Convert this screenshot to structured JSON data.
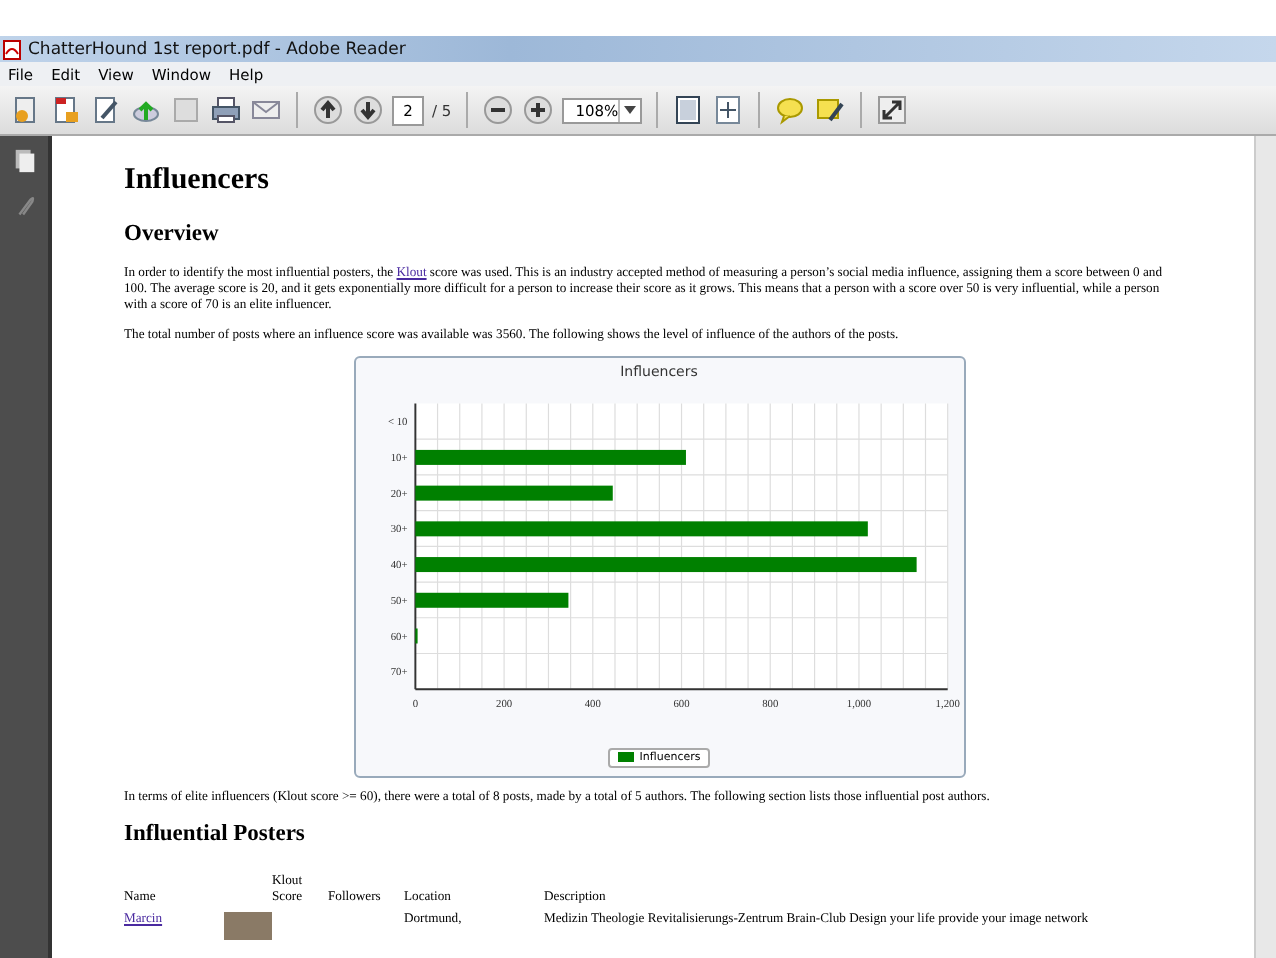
{
  "window": {
    "title": "ChatterHound 1st report.pdf - Adobe Reader"
  },
  "menu": [
    "File",
    "Edit",
    "View",
    "Window",
    "Help"
  ],
  "toolbar": {
    "page": "2",
    "page_count": "/ 5",
    "zoom": "108%"
  },
  "document": {
    "heading": "Influencers",
    "subheading": "Overview",
    "intro": {
      "before": "In order to identify the most influential posters, the",
      "link": "Klout",
      "after": "score was used. This is an industry accepted method of measuring a person’s social media influence, assigning them a score between 0 and 100. The average score is 20, and it gets exponentially more difficult for a person to increase their score as it grows. This means that a person with a score over 50 is very influential, while a person with a score of 70 is an elite influencer."
    },
    "paragraphs": [
      "The total number of posts where an influence score was available was 3560. The following shows the level of influence of the authors of the posts."
    ],
    "chart_data": {
      "type": "bar",
      "orientation": "horizontal",
      "title": "Influencers",
      "categories": [
        "< 10",
        "10+",
        "20+",
        "30+",
        "40+",
        "50+",
        "60+",
        "70+"
      ],
      "series": [
        {
          "name": "Influencers",
          "color": "#008000",
          "values": [
            0,
            610,
            445,
            1020,
            1130,
            345,
            5,
            0
          ]
        }
      ],
      "xlim": [
        0,
        1200
      ],
      "grid": true,
      "xticks": [
        0,
        200,
        400,
        600,
        800,
        {
          "value": 1000,
          "label": "1,000"
        },
        {
          "value": 1200,
          "label": "1,200"
        }
      ]
    },
    "after_chart": "In terms of elite influencers (Klout score >= 60), there were a total of 8 posts, made by a total of 5 authors. The following section lists those influential post authors.",
    "section": "Influential Posters",
    "table": {
      "columns": [
        "Name",
        "",
        "Klout Score",
        "Followers",
        "Location",
        "Description"
      ],
      "rows": [
        {
          "name": "Marcin",
          "location": "Dortmund,",
          "description": "Medizin Theologie Revitalisierungs-Zentrum Brain-Club Design your life provide your image network"
        }
      ]
    }
  }
}
